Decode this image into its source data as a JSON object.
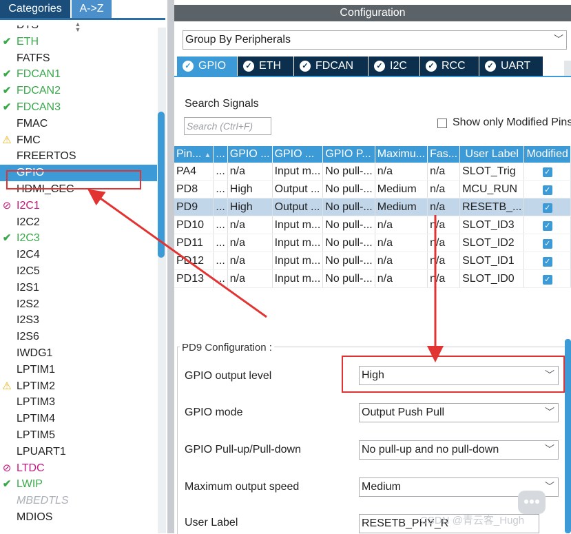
{
  "left_panel": {
    "tabs": [
      {
        "label": "Categories"
      },
      {
        "label": "A->Z"
      }
    ],
    "items": [
      {
        "label": "DTS",
        "status": "none"
      },
      {
        "label": "ETH",
        "status": "ok"
      },
      {
        "label": "FATFS",
        "status": "none"
      },
      {
        "label": "FDCAN1",
        "status": "ok"
      },
      {
        "label": "FDCAN2",
        "status": "ok"
      },
      {
        "label": "FDCAN3",
        "status": "ok"
      },
      {
        "label": "FMAC",
        "status": "none"
      },
      {
        "label": "FMC",
        "status": "warn"
      },
      {
        "label": "FREERTOS",
        "status": "none"
      },
      {
        "label": "GPIO",
        "status": "selected"
      },
      {
        "label": "HDMI_CEC",
        "status": "none"
      },
      {
        "label": "I2C1",
        "status": "err"
      },
      {
        "label": "I2C2",
        "status": "none"
      },
      {
        "label": "I2C3",
        "status": "ok"
      },
      {
        "label": "I2C4",
        "status": "none"
      },
      {
        "label": "I2C5",
        "status": "none"
      },
      {
        "label": "I2S1",
        "status": "none"
      },
      {
        "label": "I2S2",
        "status": "none"
      },
      {
        "label": "I2S3",
        "status": "none"
      },
      {
        "label": "I2S6",
        "status": "none"
      },
      {
        "label": "IWDG1",
        "status": "none"
      },
      {
        "label": "LPTIM1",
        "status": "none"
      },
      {
        "label": "LPTIM2",
        "status": "warn"
      },
      {
        "label": "LPTIM3",
        "status": "none"
      },
      {
        "label": "LPTIM4",
        "status": "none"
      },
      {
        "label": "LPTIM5",
        "status": "none"
      },
      {
        "label": "LPUART1",
        "status": "none"
      },
      {
        "label": "LTDC",
        "status": "err"
      },
      {
        "label": "LWIP",
        "status": "ok"
      },
      {
        "label": "MBEDTLS",
        "status": "disabled"
      },
      {
        "label": "MDIOS",
        "status": "none"
      }
    ]
  },
  "config": {
    "title": "Configuration",
    "group_by": "Group By Peripherals",
    "peripheral_tabs": [
      {
        "label": "GPIO",
        "active": true
      },
      {
        "label": "ETH",
        "active": false
      },
      {
        "label": "FDCAN",
        "active": false
      },
      {
        "label": "I2C",
        "active": false
      },
      {
        "label": "RCC",
        "active": false
      },
      {
        "label": "UART",
        "active": false
      }
    ],
    "search": {
      "label": "Search Signals",
      "placeholder": "Search (Ctrl+F)"
    },
    "show_modified_label": "Show only Modified Pins",
    "table": {
      "columns": [
        "Pin...",
        "...",
        "GPIO ...",
        "GPIO ...",
        "GPIO P...",
        "Maximu...",
        "Fas...",
        "User Label",
        "Modified"
      ],
      "rows": [
        {
          "pin": "PA4",
          "sig": "...",
          "level": "n/a",
          "mode": "Input m...",
          "pull": "No pull-...",
          "speed": "n/a",
          "fast": "n/a",
          "label": "SLOT_Trig",
          "modified": true
        },
        {
          "pin": "PD8",
          "sig": "...",
          "level": "High",
          "mode": "Output ...",
          "pull": "No pull-...",
          "speed": "Medium",
          "fast": "n/a",
          "label": "MCU_RUN",
          "modified": true
        },
        {
          "pin": "PD9",
          "sig": "...",
          "level": "High",
          "mode": "Output ...",
          "pull": "No pull-...",
          "speed": "Medium",
          "fast": "n/a",
          "label": "RESETB_...",
          "modified": true,
          "selected": true
        },
        {
          "pin": "PD10",
          "sig": "...",
          "level": "n/a",
          "mode": "Input m...",
          "pull": "No pull-...",
          "speed": "n/a",
          "fast": "n/a",
          "label": "SLOT_ID3",
          "modified": true
        },
        {
          "pin": "PD11",
          "sig": "...",
          "level": "n/a",
          "mode": "Input m...",
          "pull": "No pull-...",
          "speed": "n/a",
          "fast": "n/a",
          "label": "SLOT_ID2",
          "modified": true
        },
        {
          "pin": "PD12",
          "sig": "...",
          "level": "n/a",
          "mode": "Input m...",
          "pull": "No pull-...",
          "speed": "n/a",
          "fast": "n/a",
          "label": "SLOT_ID1",
          "modified": true
        },
        {
          "pin": "PD13",
          "sig": "...",
          "level": "n/a",
          "mode": "Input m...",
          "pull": "No pull-...",
          "speed": "n/a",
          "fast": "n/a",
          "label": "SLOT_ID0",
          "modified": true
        }
      ]
    },
    "pin_config": {
      "title": "PD9 Configuration :",
      "fields": [
        {
          "label": "GPIO output level",
          "value": "High"
        },
        {
          "label": "GPIO mode",
          "value": "Output Push Pull"
        },
        {
          "label": "GPIO Pull-up/Pull-down",
          "value": "No pull-up and no pull-down"
        },
        {
          "label": "Maximum output speed",
          "value": "Medium"
        }
      ],
      "user_label": {
        "label": "User Label",
        "value": "RESETB_PHY_R"
      }
    }
  },
  "watermark": "CSDN @青云客_Hugh",
  "colors": {
    "accent": "#3c9ad7",
    "dark_tab": "#0b2f4c",
    "ok": "#38a84a",
    "warn": "#e7b010",
    "err": "#c4167d",
    "annotation": "#e23333"
  }
}
